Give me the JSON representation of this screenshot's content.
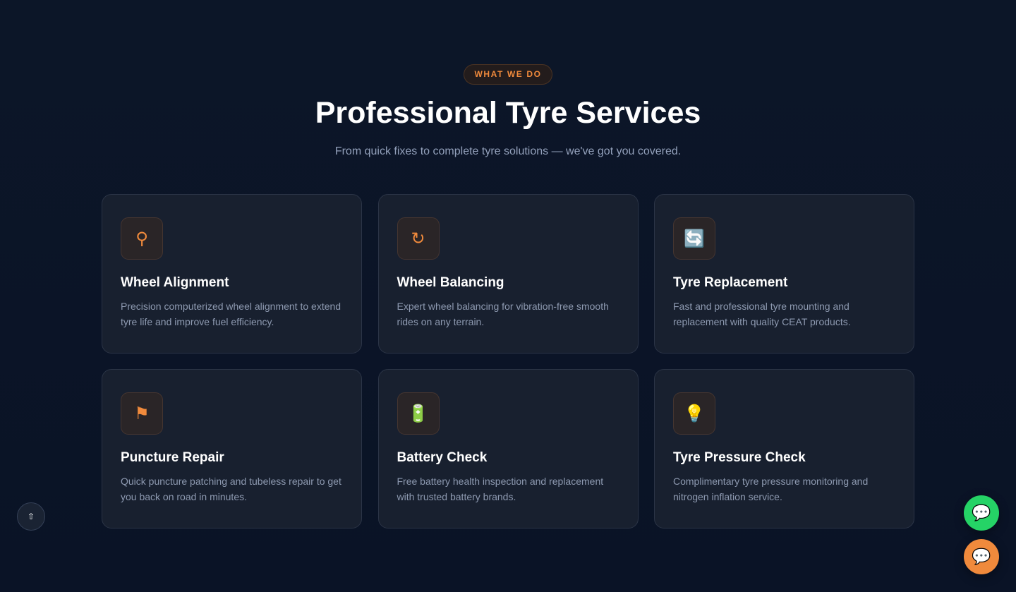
{
  "header": {
    "badge": "WHAT WE DO",
    "title": "Professional Tyre Services",
    "subtitle": "From quick fixes to complete tyre solutions — we've got you covered."
  },
  "services": [
    {
      "icon": "⚲",
      "icon_name": "alignment-icon",
      "title": "Wheel Alignment",
      "description": "Precision computerized wheel alignment to extend tyre life and improve fuel efficiency."
    },
    {
      "icon": "↻",
      "icon_name": "balancing-icon",
      "title": "Wheel Balancing",
      "description": "Expert wheel balancing for vibration-free smooth rides on any terrain."
    },
    {
      "icon": "🔄",
      "icon_name": "replace-icon",
      "title": "Tyre Replacement",
      "description": "Fast and professional tyre mounting and replacement with quality CEAT products."
    },
    {
      "icon": "⚑",
      "icon_name": "flag-icon",
      "title": "Puncture Repair",
      "description": "Quick puncture patching and tubeless repair to get you back on road in minutes."
    },
    {
      "icon": "🔋",
      "icon_name": "battery-icon",
      "title": "Battery Check",
      "description": "Free battery health inspection and replacement with trusted battery brands."
    },
    {
      "icon": "💡",
      "icon_name": "lightbulb-icon",
      "title": "Tyre Pressure Check",
      "description": "Complimentary tyre pressure monitoring and nitrogen inflation service."
    }
  ],
  "controls": {
    "scroll_top_icon": "⇧",
    "whatsapp_icon": "💬",
    "chat_icon": "💬"
  },
  "colors": {
    "accent": "#f08a3c",
    "background": "#0b1426",
    "card": "#18202f",
    "whatsapp": "#25d366"
  }
}
